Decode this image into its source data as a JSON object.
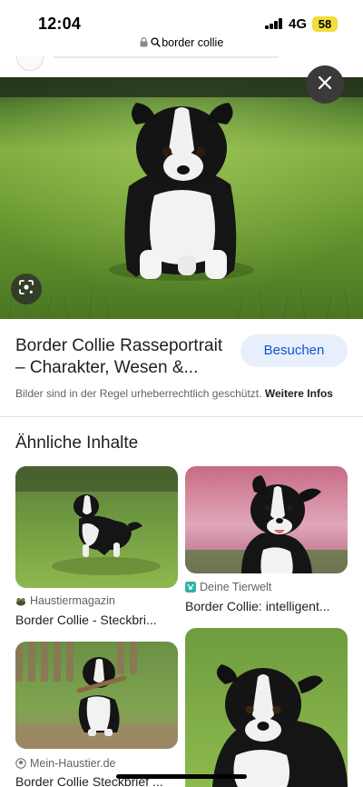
{
  "status_bar": {
    "time": "12:04",
    "network": "4G",
    "battery": "58",
    "battery_color": "#f3dd3b"
  },
  "url_bar": {
    "query": "border collie",
    "lock_icon": "lock-icon",
    "search_icon": "search-icon"
  },
  "viewer": {
    "close_icon": "close-icon",
    "lens_icon": "lens-icon"
  },
  "result": {
    "title_line1": "Border Collie Rasseportrait",
    "title_line2": "– Charakter, Wesen &...",
    "visit_label": "Besuchen",
    "copyright": "Bilder sind in der Regel urheberrechtlich geschützt.",
    "more_info": "Weitere Infos"
  },
  "related": {
    "heading": "Ähnliche Inhalte",
    "items": [
      {
        "source": "Haustiermagazin",
        "title": "Border Collie - Steckbri..."
      },
      {
        "source": "Deine Tierwelt",
        "title": "Border Collie: intelligent..."
      },
      {
        "source": "Mein-Haustier.de",
        "title": "Border Collie Steckbrief ..."
      },
      {
        "source": "",
        "title": ""
      }
    ]
  },
  "colors": {
    "accent": "#0b57d0",
    "button_bg": "#e8effc",
    "deine_tierwelt_icon": "#2bb5a1"
  }
}
